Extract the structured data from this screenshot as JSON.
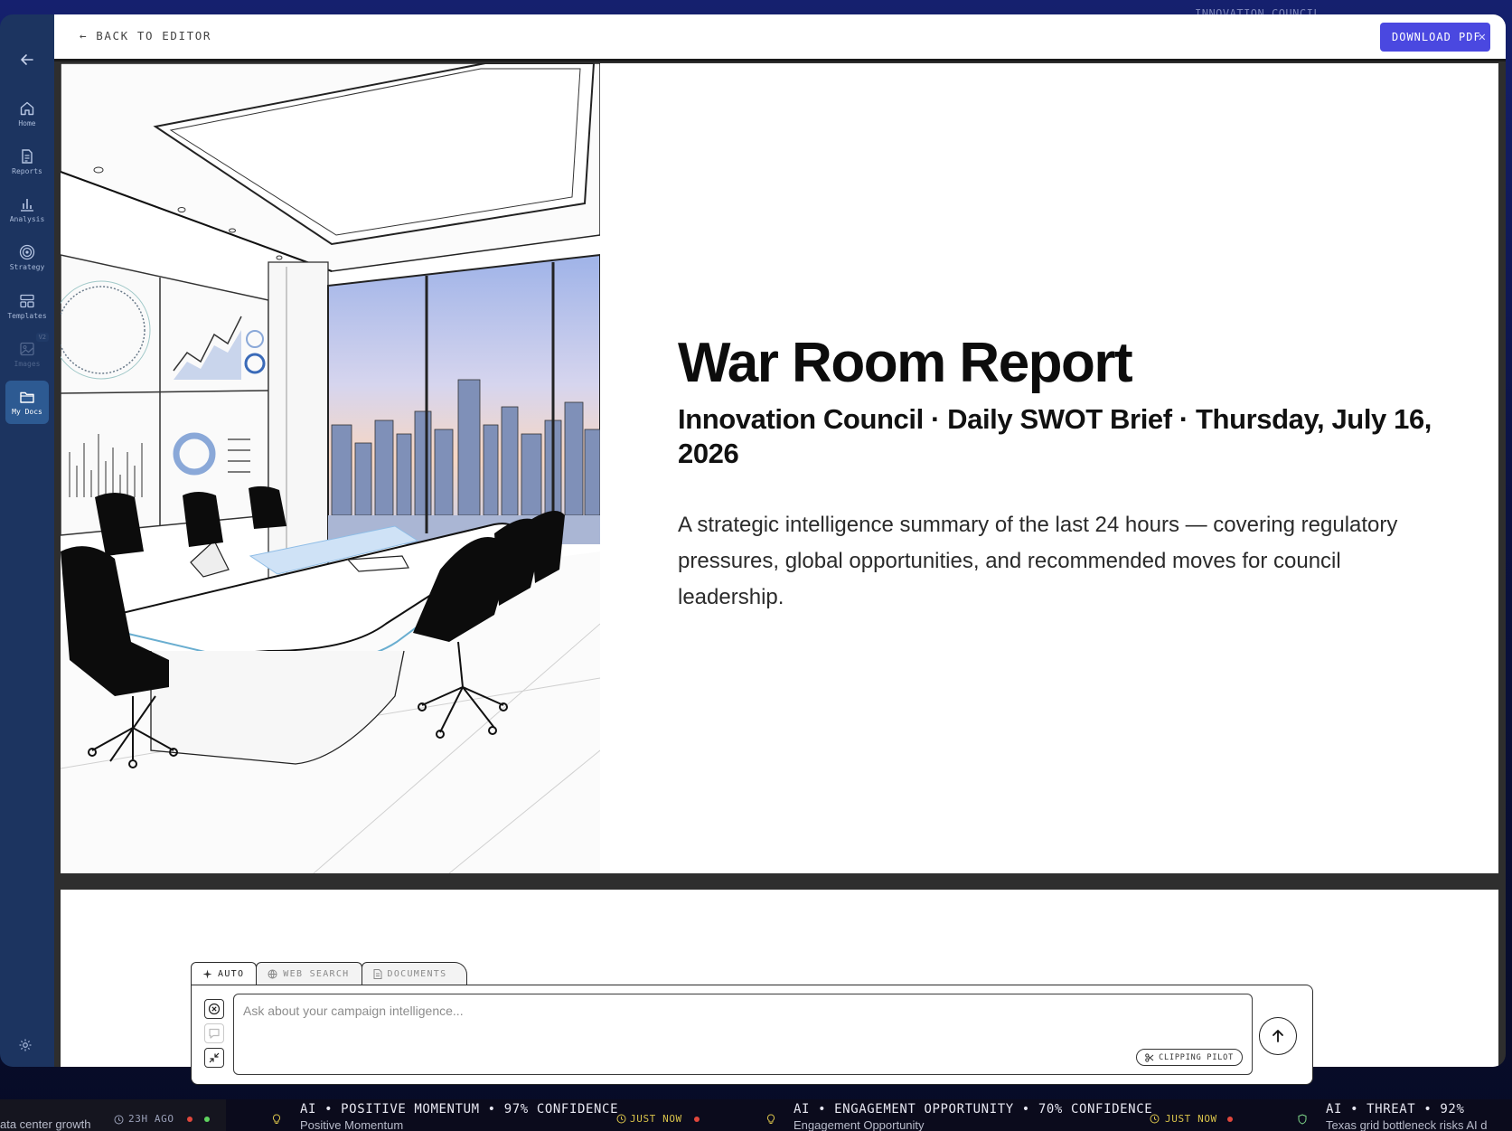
{
  "top_ghost_text": "INNOVATION COUNCIL",
  "sidebar": {
    "back_icon": "arrow-left-icon",
    "items": [
      {
        "label": "Home",
        "icon": "home-icon"
      },
      {
        "label": "Reports",
        "icon": "document-icon"
      },
      {
        "label": "Analysis",
        "icon": "bar-chart-icon"
      },
      {
        "label": "Strategy",
        "icon": "target-icon"
      },
      {
        "label": "Templates",
        "icon": "layout-icon"
      },
      {
        "label": "Images",
        "icon": "image-icon",
        "badge": "V2",
        "disabled": true
      },
      {
        "label": "My Docs",
        "icon": "folder-icon",
        "active": true
      }
    ],
    "settings_icon": "gear-icon"
  },
  "topbar": {
    "back_label": "← BACK TO EDITOR",
    "download_label": "DOWNLOAD PDF",
    "close_glyph": "✕"
  },
  "report": {
    "title": "War Room Report",
    "subtitle": "Innovation Council · Daily SWOT Brief · Thursday, July 16, 2026",
    "summary": "A strategic intelligence summary of the last 24 hours — covering regulatory pressures, global opportunities, and recommended moves for council leadership."
  },
  "composer": {
    "tabs": [
      {
        "label": "AUTO",
        "icon": "sparkle-icon",
        "active": true
      },
      {
        "label": "WEB SEARCH",
        "icon": "globe-icon"
      },
      {
        "label": "DOCUMENTS",
        "icon": "document-icon"
      }
    ],
    "placeholder": "Ask about your campaign intelligence...",
    "clip_label": "CLIPPING PILOT"
  },
  "ticker": {
    "items": [
      {
        "headline": "",
        "subtitle": "ata center growth",
        "time": "23H AGO",
        "time_color": "#9aa0b8",
        "dot_colors": [
          "#e0473c",
          "#5fd35f"
        ]
      },
      {
        "headline": "AI • POSITIVE MOMENTUM • 97% CONFIDENCE",
        "subtitle": "Positive Momentum",
        "time": "JUST NOW",
        "time_color": "#d8c24a",
        "icon": "lightbulb-icon",
        "dot_colors": [
          "#e0473c"
        ]
      },
      {
        "headline": "AI • ENGAGEMENT OPPORTUNITY • 70% CONFIDENCE",
        "subtitle": "Engagement Opportunity",
        "time": "JUST NOW",
        "time_color": "#d8c24a",
        "icon": "lightbulb-icon",
        "dot_colors": [
          "#e0473c"
        ]
      },
      {
        "headline": "AI • THREAT • 92%",
        "subtitle": "Texas grid bottleneck risks AI d",
        "icon": "shield-icon"
      }
    ]
  }
}
